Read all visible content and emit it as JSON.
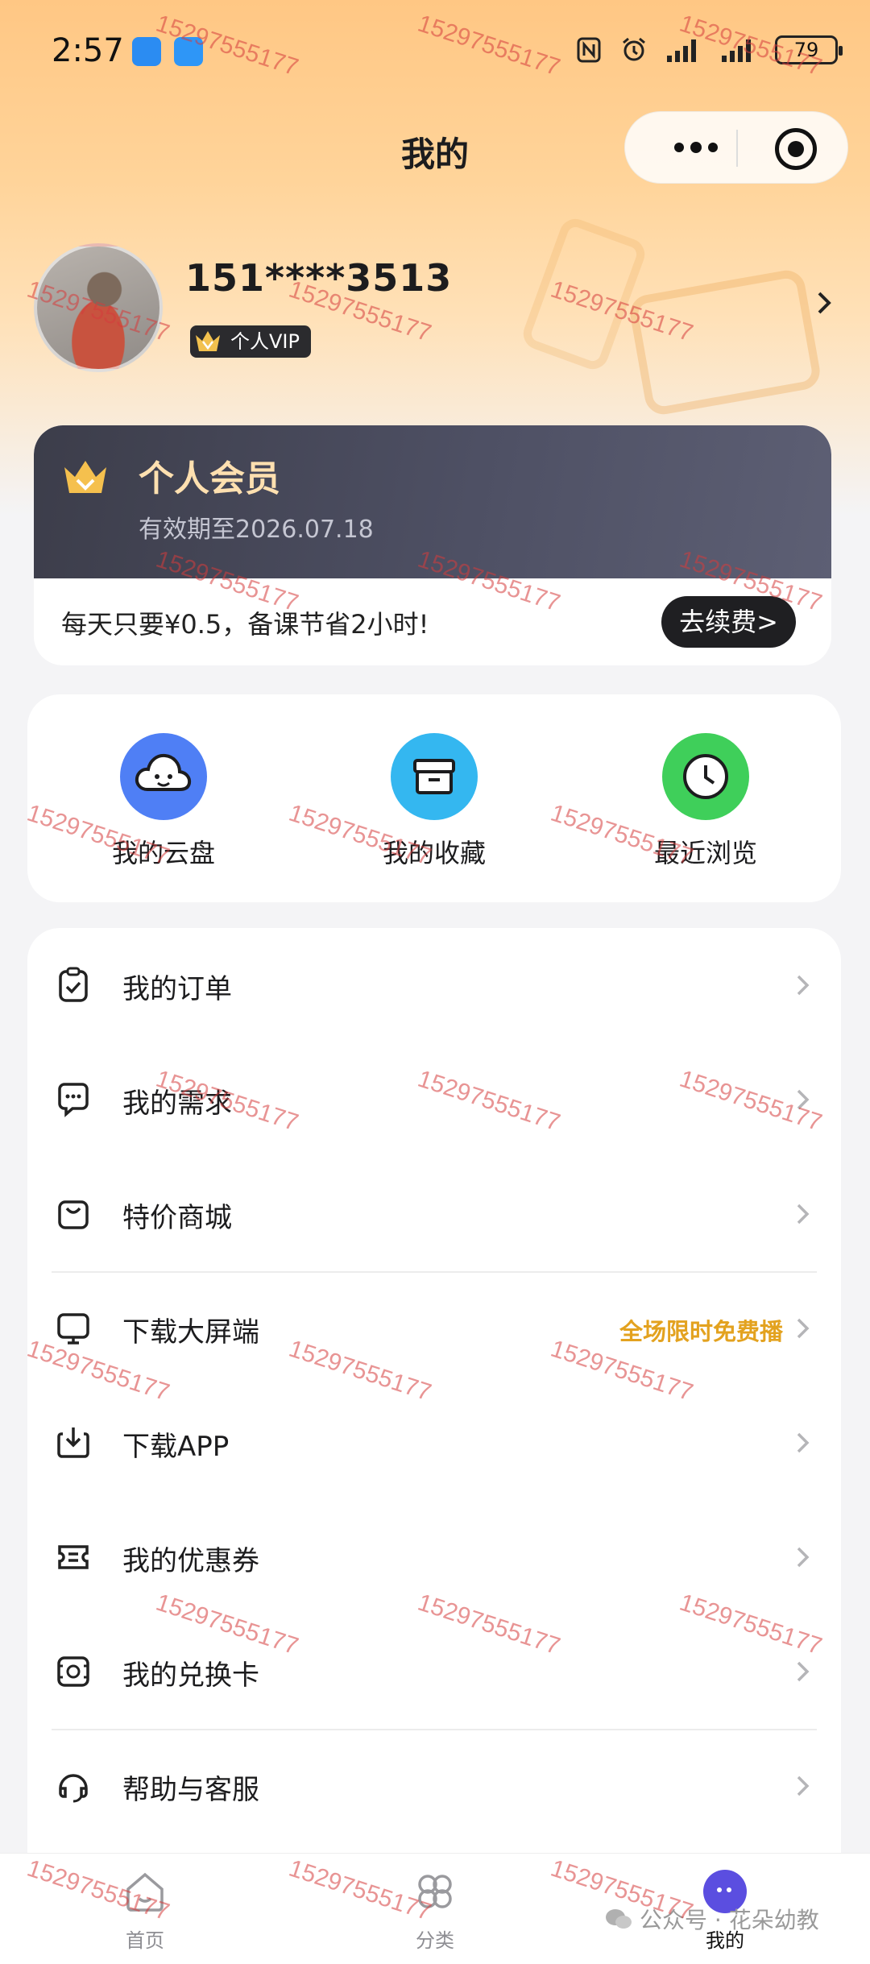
{
  "status_bar": {
    "time": "2:57",
    "battery": "79"
  },
  "header": {
    "title": "我的"
  },
  "profile": {
    "username": "151****3513",
    "vip_badge": "个人VIP"
  },
  "membership": {
    "title": "个人会员",
    "expiry": "有效期至2026.07.18",
    "promo": "每天只要¥0.5，备课节省2小时!",
    "renew_button": "去续费>"
  },
  "quick_actions": [
    {
      "label": "我的云盘",
      "icon": "cloud-icon",
      "color": "#4f7ff5"
    },
    {
      "label": "我的收藏",
      "icon": "archive-box-icon",
      "color": "#34b7f0"
    },
    {
      "label": "最近浏览",
      "icon": "clock-icon",
      "color": "#3fcf5a"
    }
  ],
  "menu": [
    {
      "label": "我的订单",
      "icon": "clipboard-check-icon"
    },
    {
      "label": "我的需求",
      "icon": "chat-bubble-icon"
    },
    {
      "label": "特价商城",
      "icon": "shopping-bag-icon"
    },
    {
      "label": "下载大屏端",
      "icon": "monitor-icon",
      "extra": "全场限时免费播"
    },
    {
      "label": "下载APP",
      "icon": "download-icon"
    },
    {
      "label": "我的优惠券",
      "icon": "coupon-icon"
    },
    {
      "label": "我的兑换卡",
      "icon": "exchange-card-icon"
    },
    {
      "label": "帮助与客服",
      "icon": "headset-icon"
    }
  ],
  "bottom_nav": [
    {
      "label": "首页",
      "icon": "home-icon",
      "active": false
    },
    {
      "label": "分类",
      "icon": "category-icon",
      "active": false
    },
    {
      "label": "我的",
      "icon": "profile-icon",
      "active": true
    }
  ],
  "watermark": {
    "text": "15297555177",
    "account": "公众号 · 花朵幼教"
  },
  "colors": {
    "accent_orange": "#ffc784",
    "promo_text": "#e3a21f",
    "member_card": "#4e5064"
  }
}
